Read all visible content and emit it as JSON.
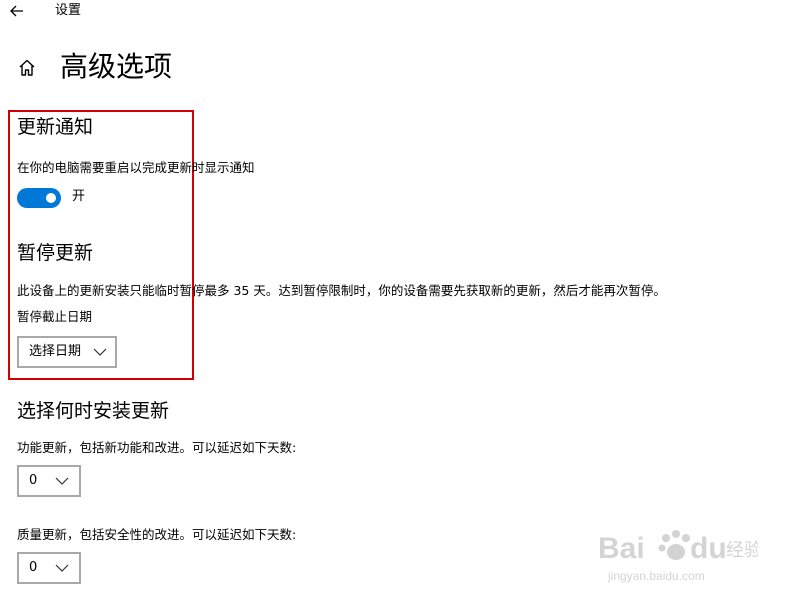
{
  "window": {
    "title": "设置"
  },
  "header": {
    "page_title": "高级选项"
  },
  "update_notifications": {
    "heading": "更新通知",
    "description": "在你的电脑需要重启以完成更新时显示通知",
    "toggle_state": "开",
    "toggle_on": true
  },
  "pause_updates": {
    "heading": "暂停更新",
    "description": "此设备上的更新安装只能临时暂停最多 35 天。达到暂停限制时，你的设备需要先获取新的更新，然后才能再次暂停。",
    "date_label": "暂停截止日期",
    "date_dropdown_value": "选择日期"
  },
  "install_timing": {
    "heading": "选择何时安装更新",
    "feature_label": "功能更新，包括新功能和改进。可以延迟如下天数:",
    "feature_value": "0",
    "quality_label": "质量更新，包括安全性的改进。可以延迟如下天数:",
    "quality_value": "0"
  },
  "watermark": {
    "brand": "Bai du 经验",
    "url": "jingyan.baidu.com"
  },
  "colors": {
    "accent": "#0078d7",
    "highlight_border": "#d40000",
    "dropdown_border": "#a9a9a9"
  }
}
